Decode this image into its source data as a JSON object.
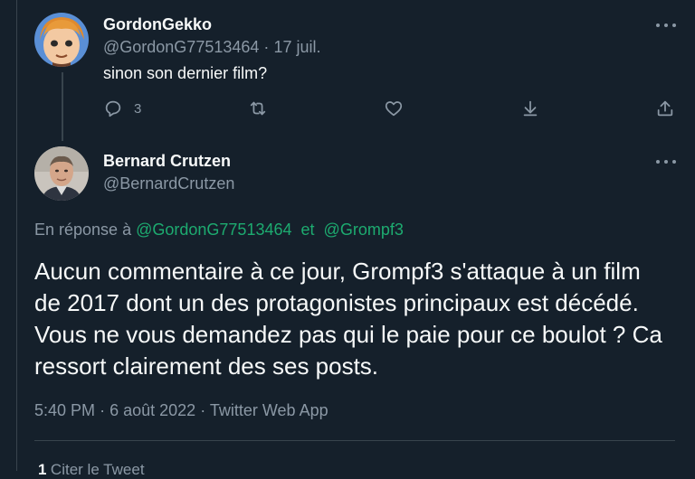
{
  "reply_tweet": {
    "display_name": "GordonGekko",
    "handle": "@GordonG77513464",
    "separator": "·",
    "date": "17 juil.",
    "text": "sinon son dernier film?",
    "reply_count": "3",
    "avatar_icon": "cartoon-avatar"
  },
  "main_tweet": {
    "display_name": "Bernard Crutzen",
    "handle": "@BernardCrutzen",
    "avatar_icon": "person-photo-avatar",
    "reply_prefix": "En réponse à",
    "mention_1": "@GordonG77513464",
    "and_word": "et",
    "mention_2": "@Grompf3",
    "text": "Aucun commentaire à ce jour, Grompf3 s'attaque à un film de 2017 dont un des protagonistes principaux est décédé. Vous ne vous demandez pas qui le paie pour ce boulot ? Ca ressort clairement des ses posts.",
    "time": "5:40 PM",
    "date": "6 août 2022",
    "dot": "·",
    "source": "Twitter Web App"
  },
  "quote_stats": {
    "count": "1",
    "label": "Citer le Tweet"
  },
  "colors": {
    "background": "#15202b",
    "text_primary": "#f7f9f9",
    "text_secondary": "#8b98a5",
    "mention": "#1dab70",
    "border": "#38444d"
  }
}
